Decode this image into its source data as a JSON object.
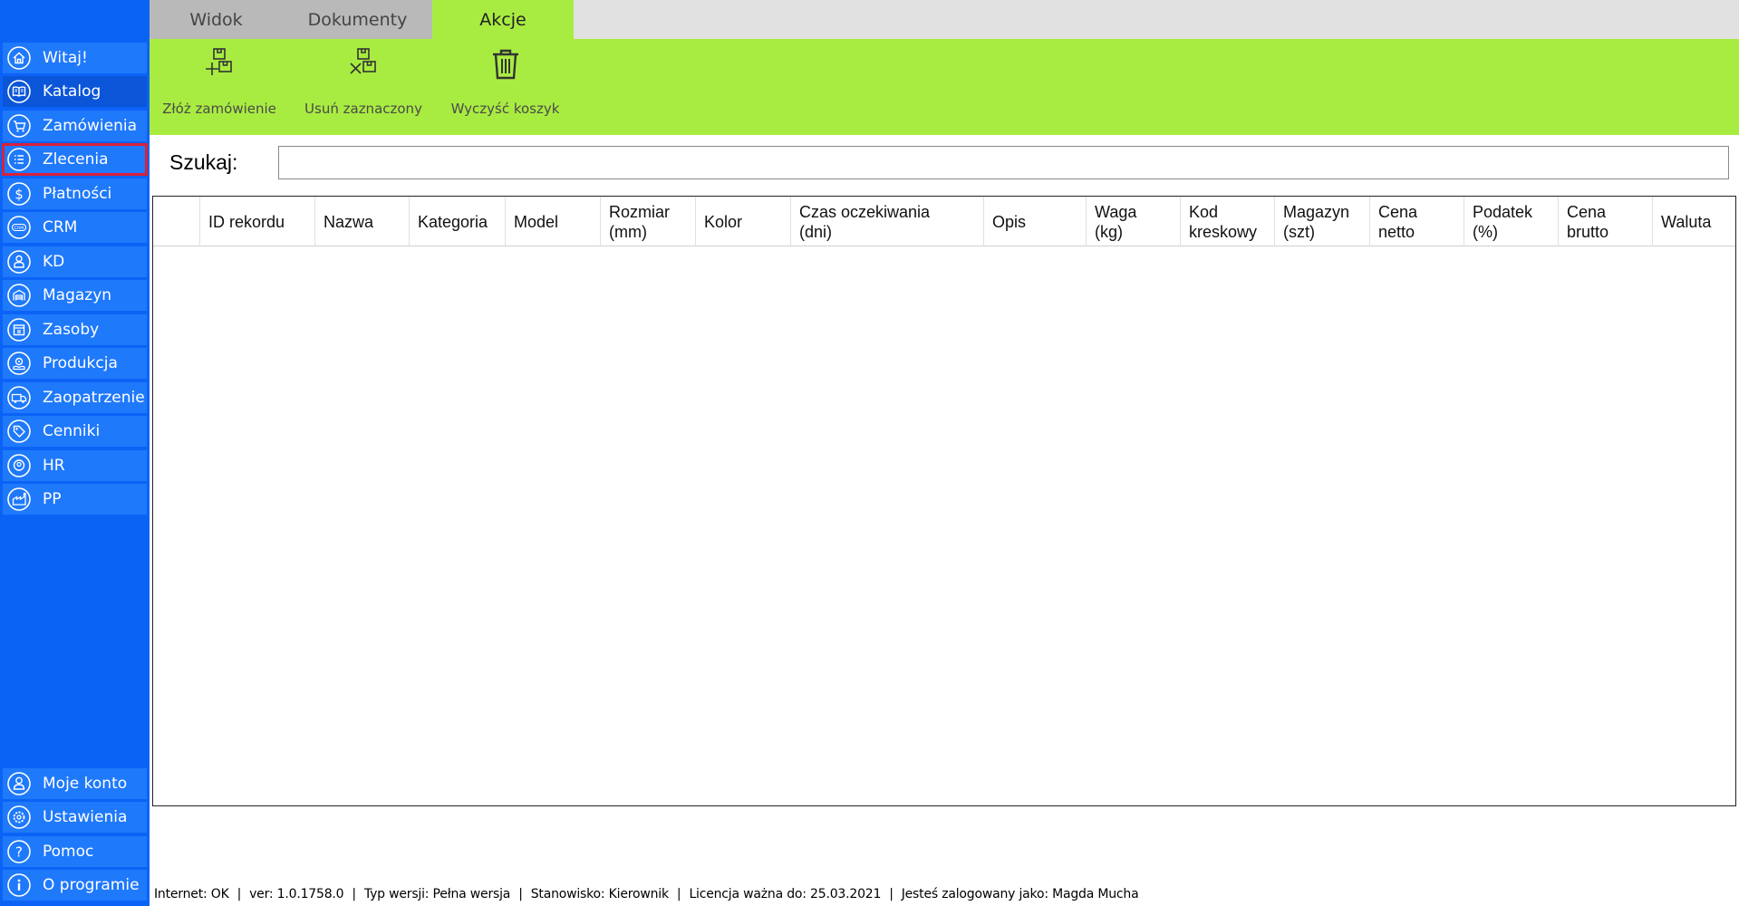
{
  "sidebar": {
    "items": [
      {
        "label": "Witaj!",
        "icon": "home-icon"
      },
      {
        "label": "Katalog",
        "icon": "book-icon"
      },
      {
        "label": "Zamówienia",
        "icon": "cart-icon"
      },
      {
        "label": "Zlecenia",
        "icon": "list-icon"
      },
      {
        "label": "Płatności",
        "icon": "dollar-icon"
      },
      {
        "label": "CRM",
        "icon": "crm-icon"
      },
      {
        "label": "KD",
        "icon": "person-lock-icon"
      },
      {
        "label": "Magazyn",
        "icon": "warehouse-icon"
      },
      {
        "label": "Zasoby",
        "icon": "box-icon"
      },
      {
        "label": "Produkcja",
        "icon": "gear-hand-icon"
      },
      {
        "label": "Zaopatrzenie",
        "icon": "truck-icon"
      },
      {
        "label": "Cenniki",
        "icon": "tag-icon"
      },
      {
        "label": "HR",
        "icon": "face-icon"
      },
      {
        "label": "PP",
        "icon": "factory-icon"
      }
    ],
    "bottom_items": [
      {
        "label": "Moje konto",
        "icon": "user-icon"
      },
      {
        "label": "Ustawienia",
        "icon": "settings-icon"
      },
      {
        "label": "Pomoc",
        "icon": "question-icon"
      },
      {
        "label": "O programie",
        "icon": "info-icon"
      }
    ]
  },
  "tabs": [
    {
      "label": "Widok"
    },
    {
      "label": "Dokumenty"
    },
    {
      "label": "Akcje"
    }
  ],
  "ribbon": {
    "buttons": [
      {
        "label": "Złóż zamówienie",
        "icon": "boxes-plus-icon"
      },
      {
        "label": "Usuń zaznaczony",
        "icon": "boxes-remove-icon"
      },
      {
        "label": "Wyczyść koszyk",
        "icon": "trash-icon"
      }
    ]
  },
  "search": {
    "label": "Szukaj:",
    "value": "",
    "placeholder": ""
  },
  "table": {
    "columns": [
      {
        "line1": "",
        "line2": ""
      },
      {
        "line1": "ID rekordu",
        "line2": ""
      },
      {
        "line1": "Nazwa",
        "line2": ""
      },
      {
        "line1": "Kategoria",
        "line2": ""
      },
      {
        "line1": "Model",
        "line2": ""
      },
      {
        "line1": "Rozmiar",
        "line2": "(mm)"
      },
      {
        "line1": "Kolor",
        "line2": ""
      },
      {
        "line1": "Czas oczekiwania",
        "line2": "(dni)"
      },
      {
        "line1": "Opis",
        "line2": ""
      },
      {
        "line1": "Waga",
        "line2": "(kg)"
      },
      {
        "line1": "Kod",
        "line2": "kreskowy"
      },
      {
        "line1": "Magazyn",
        "line2": "(szt)"
      },
      {
        "line1": "Cena",
        "line2": "netto"
      },
      {
        "line1": "Podatek",
        "line2": "(%)"
      },
      {
        "line1": "Cena",
        "line2": "brutto"
      },
      {
        "line1": "Waluta",
        "line2": ""
      }
    ],
    "rows": []
  },
  "status": {
    "internet": "Internet: OK",
    "version": "ver: 1.0.1758.0",
    "edition": "Typ wersji: Pełna wersja",
    "station": "Stanowisko: Kierownik",
    "license": "Licencja ważna do: 25.03.2021",
    "user": "Jesteś zalogowany jako: Magda Mucha"
  },
  "colors": {
    "sidebar_bg": "#0b63f6",
    "sidebar_item": "#1f79fb",
    "sidebar_active": "#0b56d8",
    "selected_outline": "#d8213a",
    "ribbon_bg": "#a9ec41"
  }
}
